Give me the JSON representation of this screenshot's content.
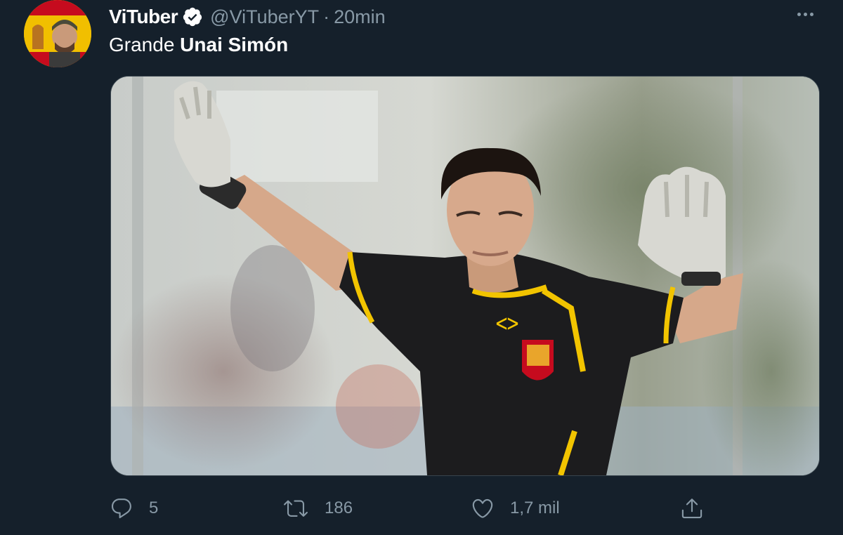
{
  "tweet": {
    "display_name": "ViTuber",
    "handle": "@ViTuberYT",
    "separator": "·",
    "time": "20min",
    "text_prefix": "Grande ",
    "text_bold": "Unai Simón",
    "icons": {
      "avatar": "avatar",
      "verified": "verified-badge-icon",
      "more": "more-dots-icon"
    }
  },
  "actions": {
    "reply": {
      "icon": "reply-icon",
      "count": "5"
    },
    "retweet": {
      "icon": "retweet-icon",
      "count": "186"
    },
    "like": {
      "icon": "heart-icon",
      "count": "1,7 mil"
    },
    "share": {
      "icon": "share-icon"
    }
  },
  "colors": {
    "background": "#15202b",
    "muted_text": "#8899a6",
    "text": "#ffffff",
    "verified_badge": "#ffffff"
  }
}
